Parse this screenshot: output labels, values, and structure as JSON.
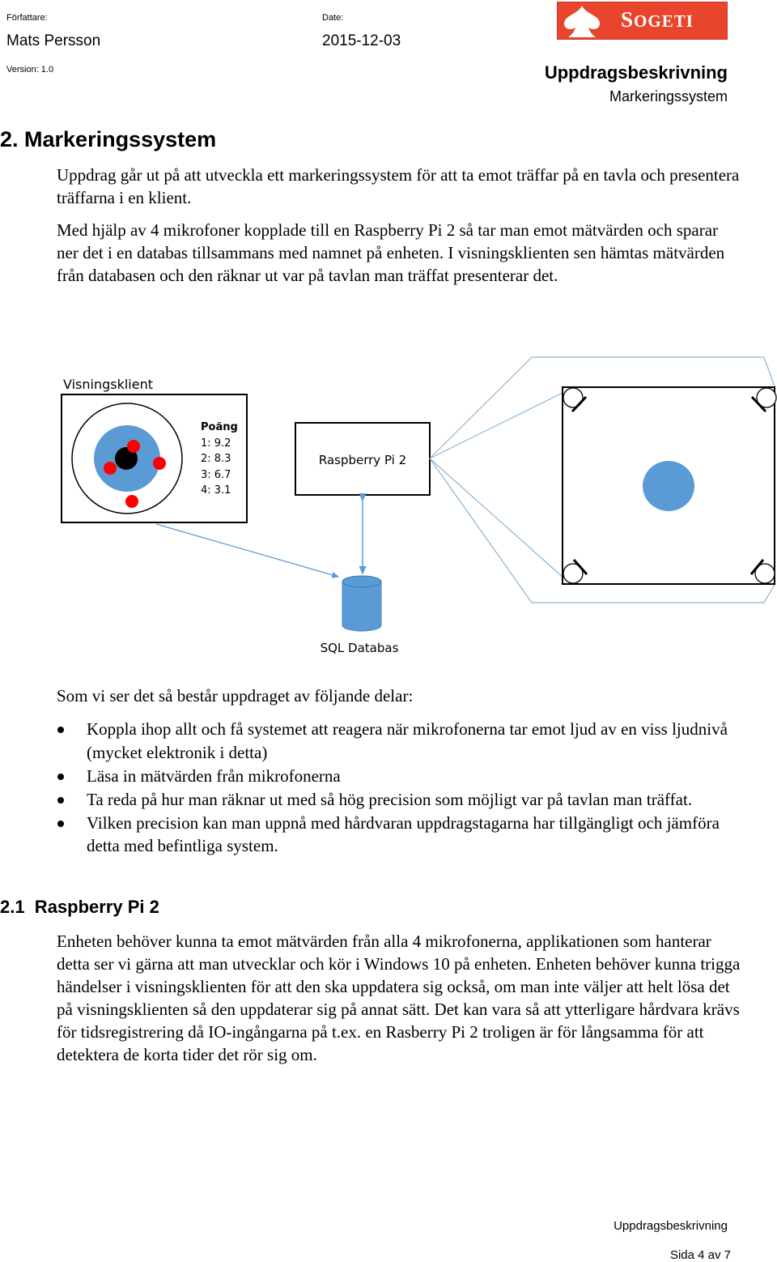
{
  "header": {
    "author_label": "Författare:",
    "author_name": "Mats Persson",
    "date_label": "Date:",
    "date_value": "2015-12-03",
    "version_label": "Version: 1.0",
    "logo_text_first": "S",
    "logo_text_rest": "OGETI",
    "logo_color": "#e8452c",
    "doc_title": "Uppdragsbeskrivning",
    "doc_subtitle": "Markeringssystem"
  },
  "section": {
    "heading": "2. Markeringssystem",
    "paragraphs": [
      "Uppdrag går ut på att utveckla ett markeringssystem för att ta emot träffar på en tavla och presentera träffarna i en klient.",
      "Med hjälp av 4 mikrofoner kopplade till en Raspberry Pi 2 så tar man emot mätvärden och sparar ner det i en databas tillsammans med namnet på enheten. I visningsklienten sen hämtas mätvärden från databasen och den räknar ut var på tavlan man träffat presenterar det."
    ],
    "diagram": {
      "client_label": "Visningsklient",
      "score_title": "Poäng",
      "scores": [
        "1: 9.2",
        "2: 8.3",
        "3: 6.7",
        "4: 3.1"
      ],
      "pi_label": "Raspberry Pi 2",
      "db_label": "SQL Databas",
      "accent_blue": "#5b9bd5",
      "hit_red": "#ff0000"
    },
    "intro_list": "Som vi ser det så består uppdraget av följande delar:",
    "bullets": [
      "Koppla ihop allt och få systemet att reagera när mikrofonerna tar emot ljud av en viss ljudnivå (mycket elektronik i detta)",
      "Läsa in mätvärden från mikrofonerna",
      "Ta reda på hur man räknar ut med så hög precision som möjligt var på tavlan man träffat.",
      "Vilken precision kan man uppnå med hårdvaran uppdragstagarna har tillgängligt och jämföra detta med befintliga system."
    ]
  },
  "subsection": {
    "heading": "2.1  Raspberry Pi 2",
    "paragraph": "Enheten behöver kunna ta emot mätvärden från alla 4 mikrofonerna, applikationen som hanterar detta ser vi gärna att man utvecklar och kör i Windows 10 på enheten. Enheten behöver kunna trigga händelser i visningsklienten för att den ska uppdatera sig också, om man inte väljer att helt lösa det på visningsklienten så den uppdaterar sig på annat sätt. Det kan vara så att ytterligare hårdvara krävs för tidsregistrering då IO-ingångarna på t.ex. en Rasberry Pi 2 troligen är för långsamma för att detektera de korta tider det rör sig om."
  },
  "footer": {
    "doc_name": "Uppdragsbeskrivning",
    "page": "Sida 4 av 7"
  }
}
